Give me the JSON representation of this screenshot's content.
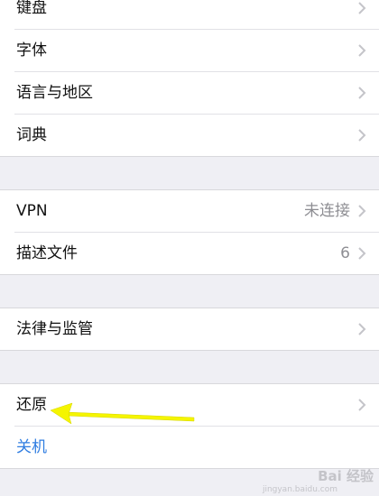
{
  "group1": {
    "keyboard_label": "键盘",
    "fonts_label": "字体",
    "language_region_label": "语言与地区",
    "dictionary_label": "词典"
  },
  "group2": {
    "vpn_label": "VPN",
    "vpn_value": "未连接",
    "profiles_label": "描述文件",
    "profiles_value": "6"
  },
  "group3": {
    "legal_label": "法律与监管"
  },
  "group4": {
    "reset_label": "还原",
    "shutdown_label": "关机"
  },
  "colors": {
    "background": "#efeff4",
    "link_blue": "#2f7de1",
    "annotation_arrow": "#f5f500"
  },
  "icons": {
    "chevron": "chevron-right-icon",
    "annotation": "yellow-arrow-annotation"
  },
  "watermark": {
    "text": "Bai 经验",
    "sub": "jingyan.baidu.com"
  }
}
